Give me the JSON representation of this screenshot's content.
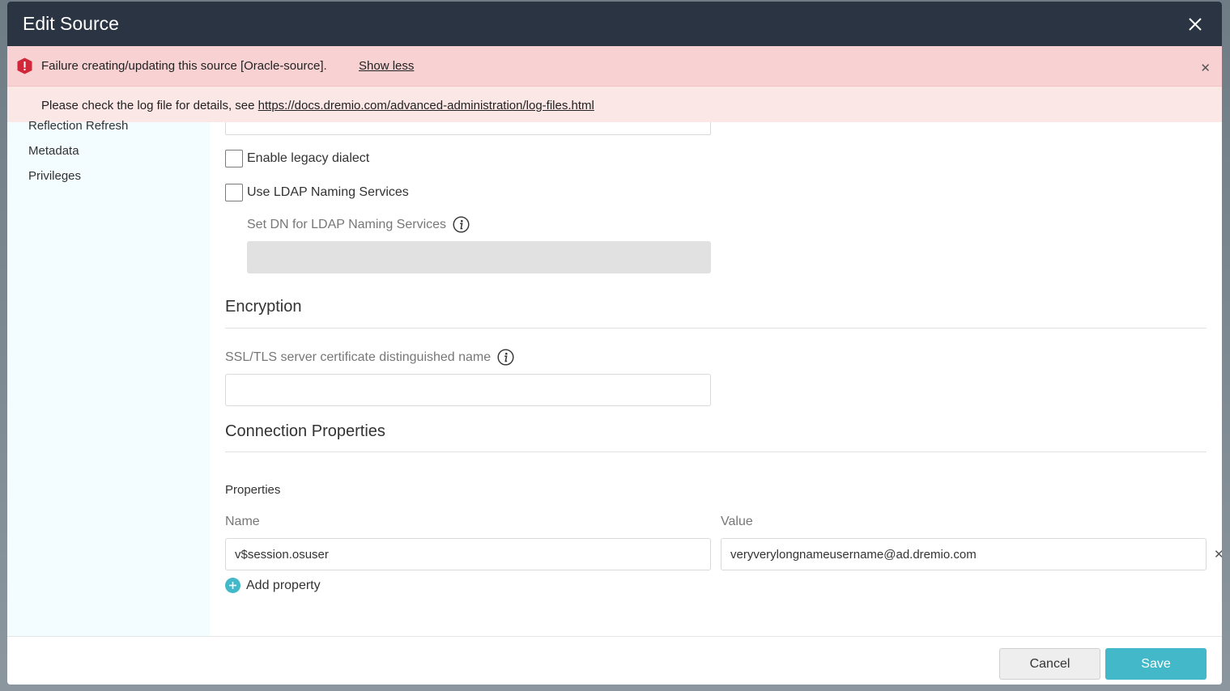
{
  "header": {
    "title": "Edit Source"
  },
  "error": {
    "message": "Failure creating/updating this source [Oracle-source].",
    "toggle_label": "Show less",
    "detail_prefix": "Please check the log file for details, see ",
    "detail_link": "https://docs.dremio.com/advanced-administration/log-files.html"
  },
  "sidebar": {
    "items": [
      {
        "label": "Reflection Refresh"
      },
      {
        "label": "Metadata"
      },
      {
        "label": "Privileges"
      }
    ]
  },
  "form": {
    "legacy_dialect_label": "Enable legacy dialect",
    "ldap_label": "Use LDAP Naming Services",
    "ldap_dn_label": "Set DN for LDAP Naming Services",
    "encryption_title": "Encryption",
    "ssl_label": "SSL/TLS server certificate distinguished name",
    "ssl_value": "",
    "connection_title": "Connection Properties",
    "properties_label": "Properties",
    "name_col": "Name",
    "value_col": "Value",
    "property_name": "v$session.osuser",
    "property_value": "veryverylongnameusername@ad.dremio.com",
    "add_property_label": "Add property"
  },
  "footer": {
    "cancel_label": "Cancel",
    "save_label": "Save"
  },
  "colors": {
    "header_bg": "#2a3442",
    "error_bg": "#f8d2d3",
    "accent": "#43b8c9",
    "error_icon": "#d0283a"
  }
}
